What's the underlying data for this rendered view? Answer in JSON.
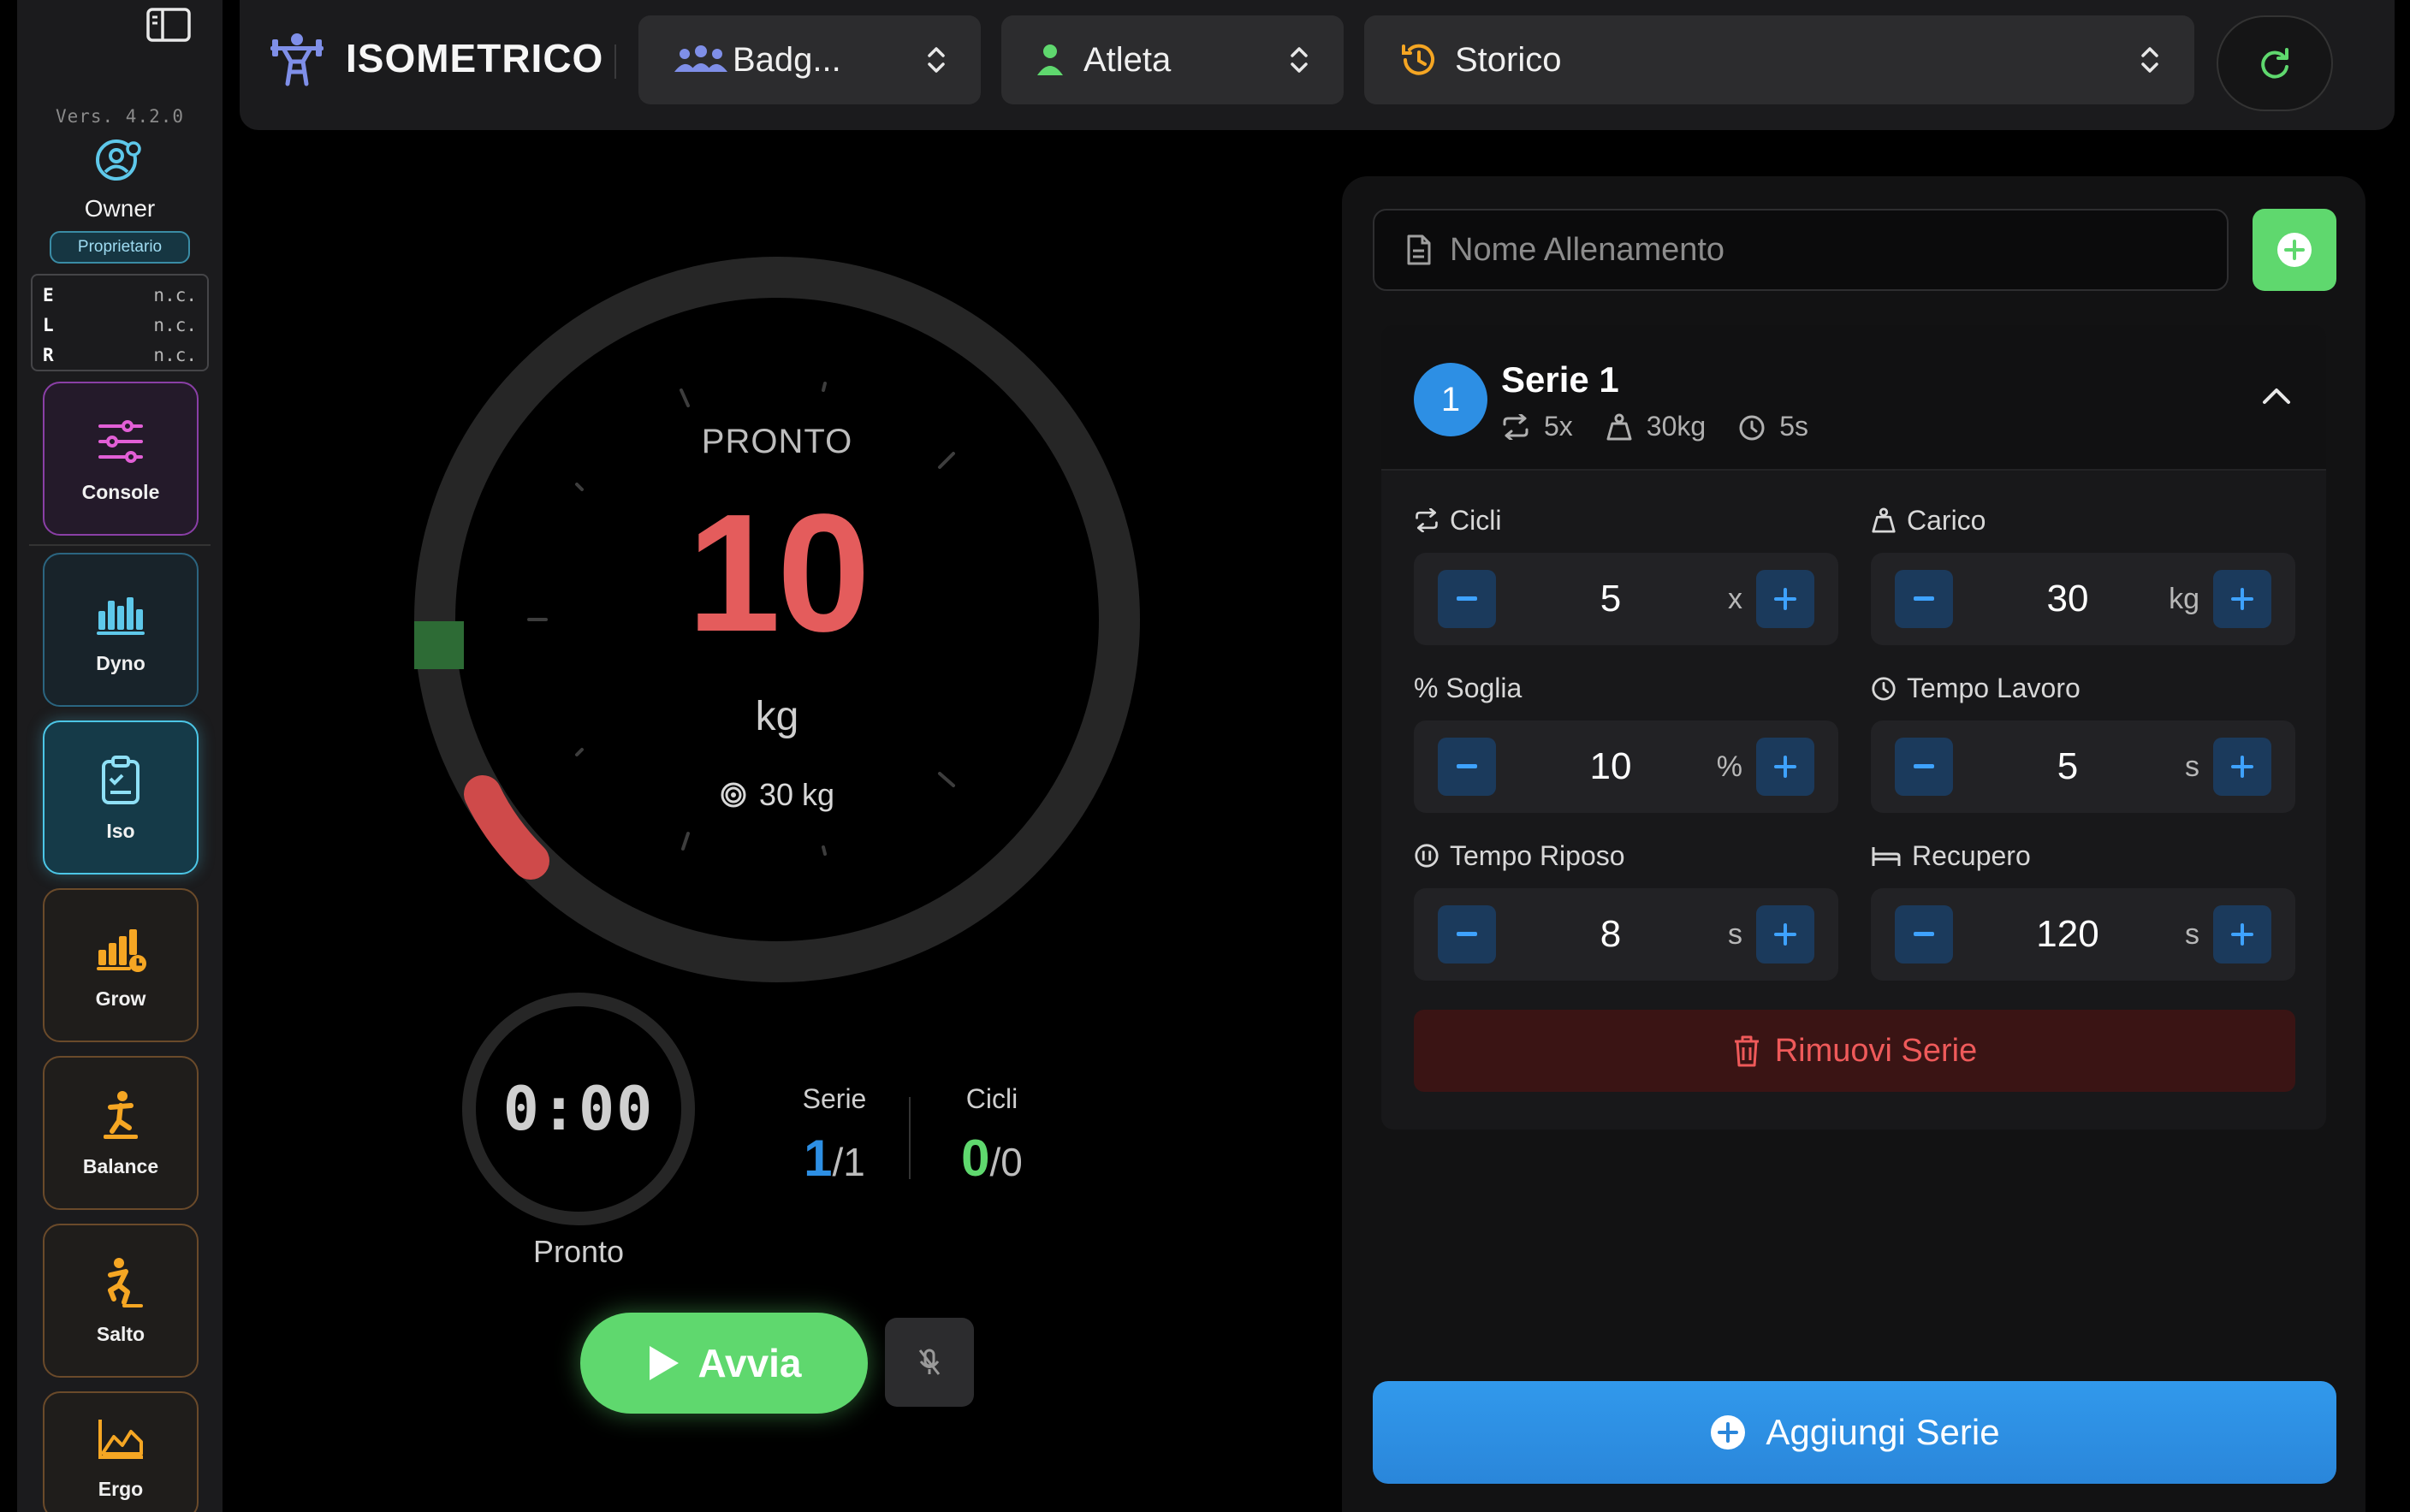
{
  "sidebar": {
    "version": "Vers. 4.2.0",
    "user_name": "Owner",
    "user_role": "Proprietario",
    "elr": [
      {
        "key": "E",
        "value": "n.c."
      },
      {
        "key": "L",
        "value": "n.c."
      },
      {
        "key": "R",
        "value": "n.c."
      }
    ],
    "nav": [
      {
        "label": "Console",
        "icon": "sliders-icon"
      },
      {
        "label": "Dyno",
        "icon": "bar-chart-icon"
      },
      {
        "label": "Iso",
        "icon": "clipboard-check-icon",
        "active": true
      },
      {
        "label": "Grow",
        "icon": "growth-chart-icon"
      },
      {
        "label": "Balance",
        "icon": "balance-figure-icon"
      },
      {
        "label": "Salto",
        "icon": "jump-figure-icon"
      },
      {
        "label": "Ergo",
        "icon": "area-chart-icon"
      }
    ]
  },
  "topbar": {
    "brand": "ISOMETRICO",
    "group_select": "Badg...",
    "athlete_select": "Atleta",
    "history_select": "Storico"
  },
  "gauge": {
    "status": "PRONTO",
    "value": "10",
    "unit": "kg",
    "target": "30 kg"
  },
  "timer": {
    "time": "0:00",
    "label": "Pronto"
  },
  "counters": {
    "serie_label": "Serie",
    "serie_current": "1",
    "serie_total": "/1",
    "cicli_label": "Cicli",
    "cicli_current": "0",
    "cicli_total": "/0"
  },
  "controls": {
    "start_label": "Avvia"
  },
  "workout": {
    "name_placeholder": "Nome Allenamento",
    "series": {
      "number": "1",
      "title": "Serie 1",
      "meta_reps": "5x",
      "meta_load": "30kg",
      "meta_time": "5s"
    },
    "fields": {
      "cicli": {
        "label": "Cicli",
        "value": "5",
        "unit": "x"
      },
      "carico": {
        "label": "Carico",
        "value": "30",
        "unit": "kg"
      },
      "soglia": {
        "label": "% Soglia",
        "value": "10",
        "unit": "%"
      },
      "tempo_lavoro": {
        "label": "Tempo Lavoro",
        "value": "5",
        "unit": "s"
      },
      "tempo_riposo": {
        "label": "Tempo Riposo",
        "value": "8",
        "unit": "s"
      },
      "recupero": {
        "label": "Recupero",
        "value": "120",
        "unit": "s"
      }
    },
    "remove_label": "Rimuovi Serie",
    "add_label": "Aggiungi Serie"
  },
  "colors": {
    "accent_blue": "#2d8fe4",
    "accent_green": "#5fd86e",
    "accent_red": "#e45c5c",
    "iso_active": "#4cc6e6"
  }
}
